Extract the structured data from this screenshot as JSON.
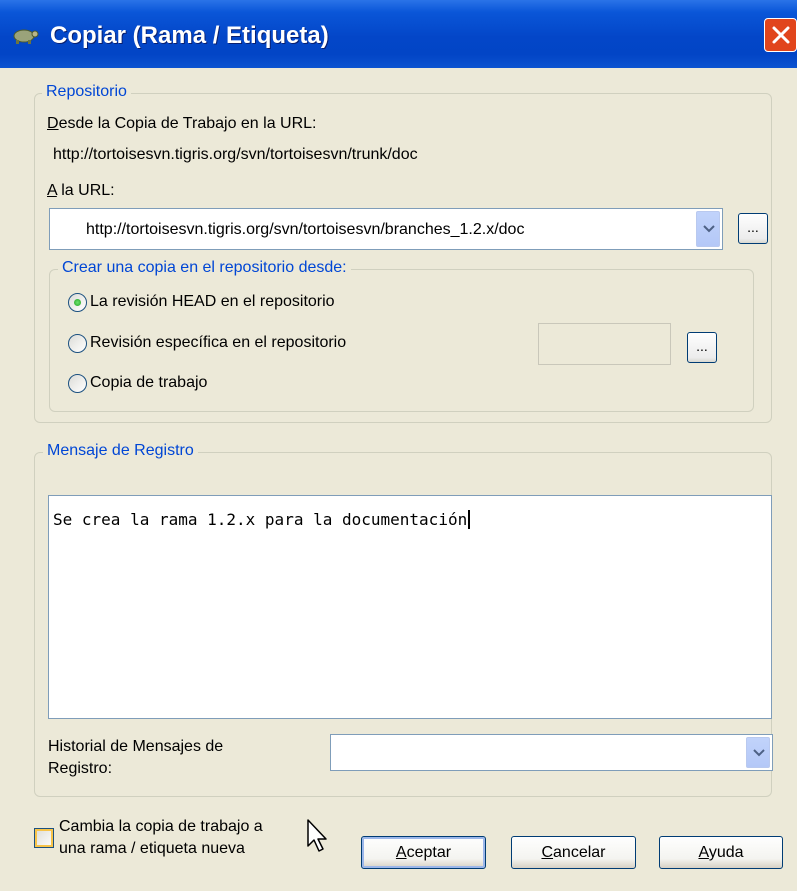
{
  "window": {
    "title": "Copiar (Rama / Etiqueta)"
  },
  "repository": {
    "legend": "Repositorio",
    "from_label_pre": "D",
    "from_label_rest": "esde la Copia de Trabajo en la URL:",
    "from_url": "http://tortoisesvn.tigris.org/svn/tortoisesvn/trunk/doc",
    "to_label_pre": "A",
    "to_label_rest": " la URL:",
    "to_url": "http://tortoisesvn.tigris.org/svn/tortoisesvn/branches_1.2.x/doc",
    "browse_label": "...",
    "copy_from": {
      "legend": "Crear una copia en el repositorio desde:",
      "options": [
        {
          "label": "La revisión HEAD en el repositorio",
          "checked": true
        },
        {
          "label": "Revisión específica en el repositorio",
          "checked": false
        },
        {
          "label": "Copia de trabajo",
          "checked": false
        }
      ],
      "revision_value": "",
      "browse_label": "..."
    }
  },
  "log": {
    "legend": "Mensaje de Registro",
    "message": "Se crea la rama 1.2.x para la documentación",
    "history_label": "Historial de Mensajes de\nRegistro:",
    "history_label_line1": "Historial de Mensajes de",
    "history_label_line2": "Registro:",
    "history_value": ""
  },
  "switch": {
    "label_line1": "Cambia la copia de trabajo a",
    "label_line2": "una rama / etiqueta nueva",
    "checked": false
  },
  "buttons": {
    "ok_pre": "A",
    "ok_rest": "ceptar",
    "cancel_pre": "C",
    "cancel_rest": "ancelar",
    "help_pre": "A",
    "help_rest": "yuda"
  },
  "colors": {
    "titlebar": "#0346c8",
    "dialog_bg": "#ece9d8",
    "legend_text": "#0046d5",
    "close": "#e1451c"
  }
}
